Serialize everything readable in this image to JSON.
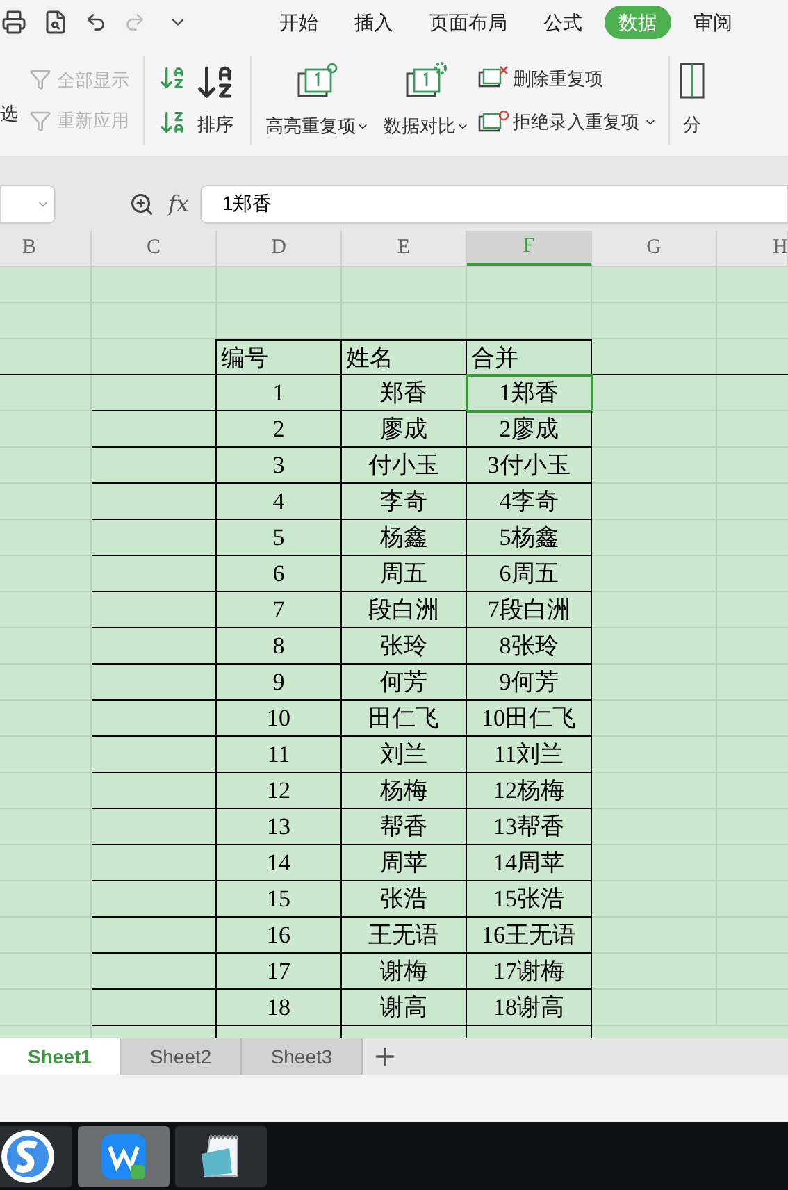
{
  "tabs": [
    {
      "label": "开始",
      "selected": false
    },
    {
      "label": "插入",
      "selected": false
    },
    {
      "label": "页面布局",
      "selected": false
    },
    {
      "label": "公式",
      "selected": false
    },
    {
      "label": "数据",
      "selected": true
    },
    {
      "label": "审阅",
      "selected": false
    }
  ],
  "ribbon": {
    "filter_label": "选",
    "show_all": {
      "label": "全部显示",
      "disabled": true
    },
    "reapply": {
      "label": "重新应用",
      "disabled": true
    },
    "sort": "排序",
    "highlight_duplicates": "高亮重复项",
    "compare": "数据对比",
    "remove_duplicates": "删除重复项",
    "reject_duplicates": "拒绝录入重复项",
    "split": "分"
  },
  "formula_bar": {
    "fx": "fx",
    "value": "1郑香"
  },
  "columns": [
    {
      "label": "B",
      "selected": false
    },
    {
      "label": "C",
      "selected": false
    },
    {
      "label": "D",
      "selected": false
    },
    {
      "label": "E",
      "selected": false
    },
    {
      "label": "F",
      "selected": true
    },
    {
      "label": "G",
      "selected": false
    },
    {
      "label": "H",
      "selected": false
    }
  ],
  "table": {
    "headers": [
      "编号",
      "姓名",
      "合并"
    ],
    "rows": [
      {
        "no": "1",
        "name": "郑香",
        "merged": "1郑香",
        "selected": true
      },
      {
        "no": "2",
        "name": "廖成",
        "merged": "2廖成",
        "selected": false
      },
      {
        "no": "3",
        "name": "付小玉",
        "merged": "3付小玉",
        "selected": false
      },
      {
        "no": "4",
        "name": "李奇",
        "merged": "4李奇",
        "selected": false
      },
      {
        "no": "5",
        "name": "杨鑫",
        "merged": "5杨鑫",
        "selected": false
      },
      {
        "no": "6",
        "name": "周五",
        "merged": "6周五",
        "selected": false
      },
      {
        "no": "7",
        "name": "段白洲",
        "merged": "7段白洲",
        "selected": false
      },
      {
        "no": "8",
        "name": "张玲",
        "merged": "8张玲",
        "selected": false
      },
      {
        "no": "9",
        "name": "何芳",
        "merged": "9何芳",
        "selected": false
      },
      {
        "no": "10",
        "name": "田仁飞",
        "merged": "10田仁飞",
        "selected": false
      },
      {
        "no": "11",
        "name": "刘兰",
        "merged": "11刘兰",
        "selected": false
      },
      {
        "no": "12",
        "name": "杨梅",
        "merged": "12杨梅",
        "selected": false
      },
      {
        "no": "13",
        "name": "帮香",
        "merged": "13帮香",
        "selected": false
      },
      {
        "no": "14",
        "name": "周苹",
        "merged": "14周苹",
        "selected": false
      },
      {
        "no": "15",
        "name": "张浩",
        "merged": "15张浩",
        "selected": false
      },
      {
        "no": "16",
        "name": "王无语",
        "merged": "16王无语",
        "selected": false
      },
      {
        "no": "17",
        "name": "谢梅",
        "merged": "17谢梅",
        "selected": false
      },
      {
        "no": "18",
        "name": "谢高",
        "merged": "18谢高",
        "selected": false
      }
    ]
  },
  "sheet_tabs": [
    {
      "label": "Sheet1",
      "selected": true
    },
    {
      "label": "Sheet2",
      "selected": false
    },
    {
      "label": "Sheet3",
      "selected": false
    }
  ]
}
